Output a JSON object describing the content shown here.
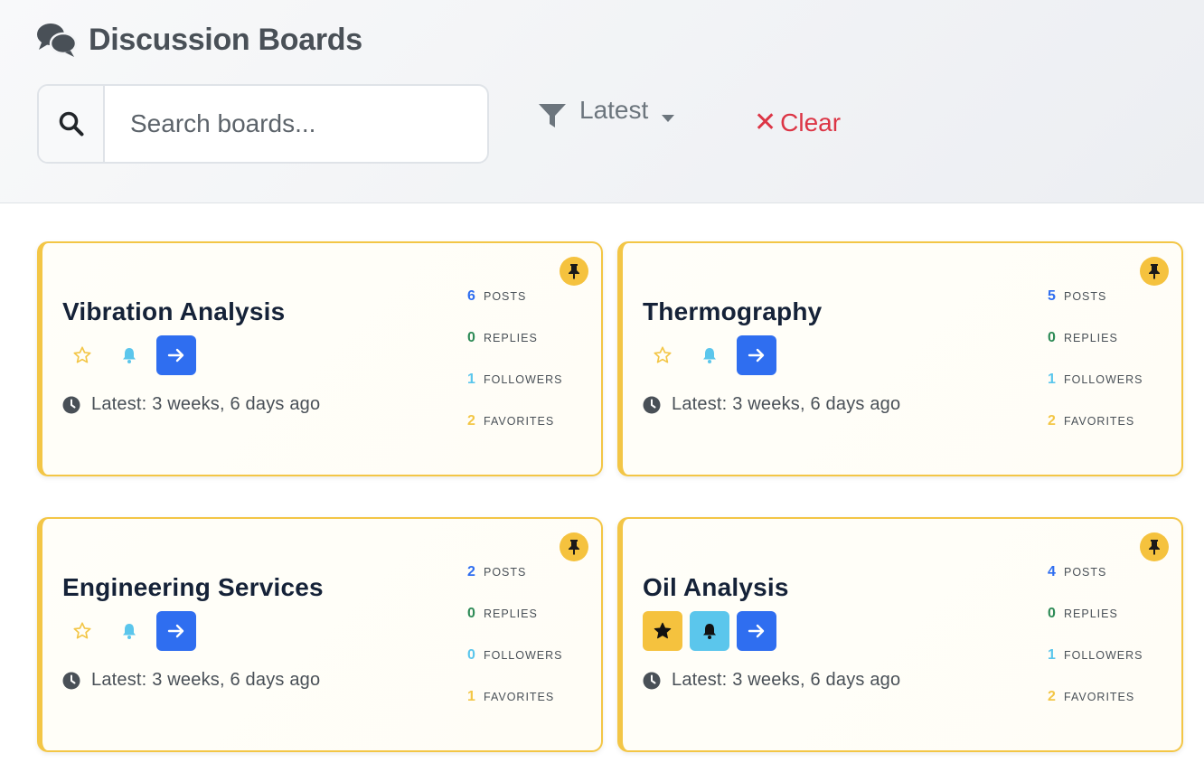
{
  "header": {
    "title": "Discussion Boards",
    "search": {
      "placeholder": "Search boards...",
      "value": ""
    },
    "filter": {
      "label": "Latest"
    },
    "clear": {
      "icon": "✕",
      "label": "Clear"
    }
  },
  "stat_labels": {
    "posts": "POSTS",
    "replies": "REPLIES",
    "followers": "FOLLOWERS",
    "favorites": "FAVORITES"
  },
  "boards": [
    {
      "title": "Vibration Analysis",
      "latest": "Latest: 3 weeks, 6 days ago",
      "posts": "6",
      "replies": "0",
      "followers": "1",
      "favorites": "2",
      "favorited": false,
      "following": false,
      "pinned": true
    },
    {
      "title": "Thermography",
      "latest": "Latest: 3 weeks, 6 days ago",
      "posts": "5",
      "replies": "0",
      "followers": "1",
      "favorites": "2",
      "favorited": false,
      "following": false,
      "pinned": true
    },
    {
      "title": "Engineering Services",
      "latest": "Latest: 3 weeks, 6 days ago",
      "posts": "2",
      "replies": "0",
      "followers": "0",
      "favorites": "1",
      "favorited": false,
      "following": false,
      "pinned": true
    },
    {
      "title": "Oil Analysis",
      "latest": "Latest: 3 weeks, 6 days ago",
      "posts": "4",
      "replies": "0",
      "followers": "1",
      "favorites": "2",
      "favorited": true,
      "following": true,
      "pinned": true
    }
  ],
  "colors": {
    "accent_blue": "#2f6ef0",
    "pin_yellow": "#f5c23e",
    "follow_cyan": "#5bc6ec",
    "replies_green": "#2e8b57",
    "danger_red": "#dc3545"
  },
  "icons": {
    "title": "chat-bubbles-icon",
    "search": "search-icon",
    "filter": "filter-icon",
    "caret": "caret-down-icon",
    "clear": "close-icon",
    "pin": "pin-icon",
    "favorite": "star-icon",
    "follow": "bell-icon",
    "open": "arrow-right-icon",
    "latest": "clock-icon"
  }
}
